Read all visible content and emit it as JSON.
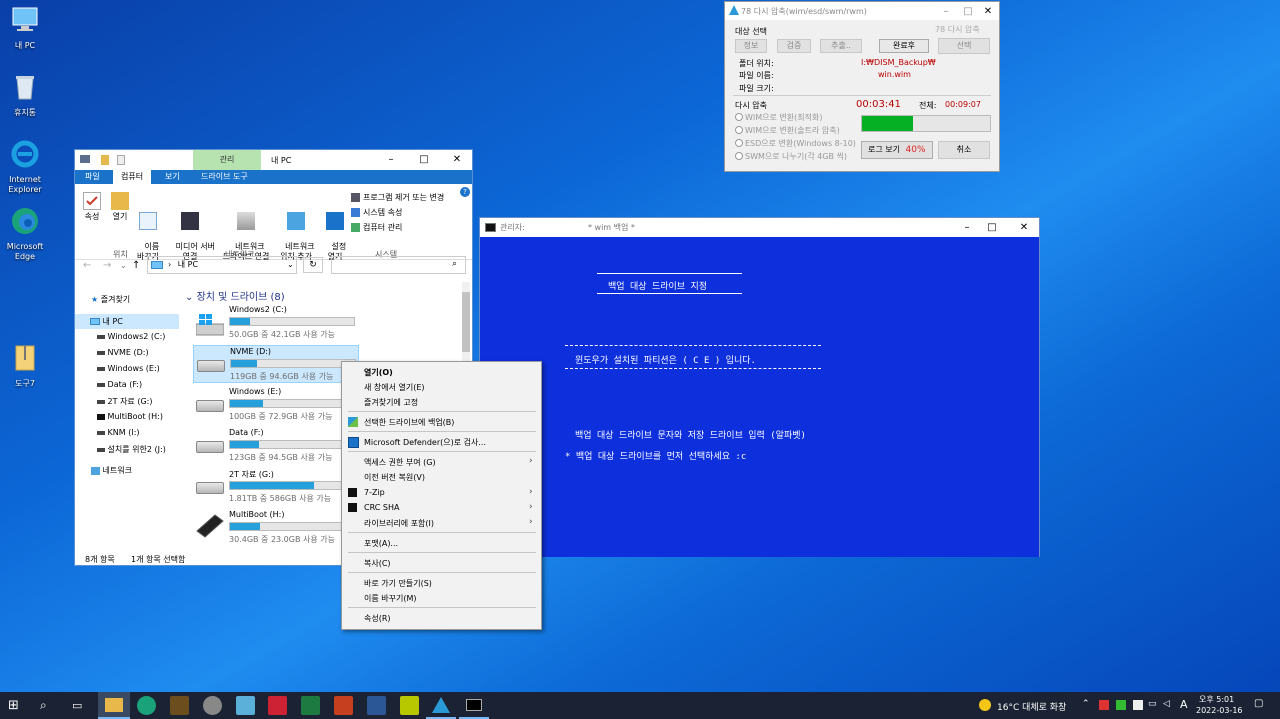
{
  "desktop": {
    "icons": [
      {
        "label": "내 PC"
      },
      {
        "label": "휴지통"
      },
      {
        "label": "Internet Explorer"
      },
      {
        "label": "Microsoft Edge"
      },
      {
        "label": "도구7"
      }
    ]
  },
  "explorer": {
    "ribbon_manage": "관리",
    "title": "내 PC",
    "tabs": [
      "파일",
      "컴퓨터",
      "보기",
      "드라이브 도구"
    ],
    "ribbon": {
      "props": "속성",
      "open": "열기",
      "rename": "이름\n바꾸기",
      "media": "미디어 서버\n연결",
      "netdrive": "네트워크\n드라이브 연결",
      "netloc": "네트워크\n위치 추가",
      "settings": "설정\n열기",
      "uninstall": "프로그램 제거 또는 변경",
      "sysprops": "시스템 속성",
      "compmgmt": "컴퓨터 관리",
      "group_location": "위치",
      "group_network": "네트워크",
      "group_system": "시스템"
    },
    "address": "내 PC",
    "address_sep": "›",
    "nav": {
      "quick": "즐겨찾기",
      "thispc": "내 PC",
      "network": "네트워크",
      "drives": [
        "Windows2 (C:)",
        "NVME (D:)",
        "Windows (E:)",
        "Data (F:)",
        "2T 자료 (G:)",
        "MultiBoot (H:)",
        "KNM (I:)",
        "설치를 위한2 (J:)"
      ]
    },
    "section": "장치 및 드라이브 (8)",
    "drives": [
      {
        "name": "Windows2 (C:)",
        "size": "50.0GB 중 42.1GB 사용 가능",
        "used": 0.16
      },
      {
        "name": "NVME (D:)",
        "size": "119GB 중 94.6GB 사용 가능",
        "used": 0.21
      },
      {
        "name": "Windows (E:)",
        "size": "100GB 중 72.9GB 사용 가능",
        "used": 0.27
      },
      {
        "name": "Data (F:)",
        "size": "123GB 중 94.5GB 사용 가능",
        "used": 0.23
      },
      {
        "name": "2T 자료 (G:)",
        "size": "1.81TB 중 586GB 사용 가능",
        "used": 0.68
      },
      {
        "name": "MultiBoot (H:)",
        "size": "30.4GB 중 23.0GB 사용 가능",
        "used": 0.24
      }
    ],
    "status_count": "8개 항목",
    "status_sel": "1개 항목 선택함"
  },
  "context_menu": [
    "열기(O)",
    "새 창에서 열기(E)",
    "즐겨찾기에 고정",
    "선택한 드라이브에 백업(B)",
    "Microsoft Defender(으)로 검사...",
    "액세스 권한 부여 (G)",
    "이전 버전 복원(V)",
    "7-Zip",
    "CRC SHA",
    "라이브러리에 포함(I)",
    "포맷(A)...",
    "복사(C)",
    "바로 가기 만들기(S)",
    "이름 바꾸기(M)",
    "속성(R)"
  ],
  "cmd": {
    "title": "관리자:",
    "title2": "* wim 백업 *",
    "heading": "백업 대상 드라이브 지정",
    "line1": "윈도우가 설치된 파티션은 ( C E ) 입니다.",
    "line2": "백업 대상 드라이브 문자와 저장 드라이브 입력 (알파벳)",
    "line3": "* 백업 대상 드라이브를 먼저 선택하세요 :c"
  },
  "wim": {
    "title": "78 다시 압축(wim/esd/swm/rwm)",
    "ghost_title": "78 다시 압축",
    "target_label": "대상 선택",
    "btns": [
      "정보",
      "검증",
      "추출..",
      "완료후",
      "선택"
    ],
    "folder_label": "폴더 위치:",
    "folder_val": "I:₩DISM_Backup₩",
    "file_label": "파일 이름:",
    "file_val": "win.wim",
    "size_label": "파일 크기:",
    "recomp": "다시 압축",
    "elapsed": "00:03:41",
    "total_label": "전체:",
    "total": "00:09:07",
    "opts": [
      "WIM으로 변환(최적화)",
      "WIM으로 변환(솔트라 압축)",
      "ESD으로 변환(Windows 8-10)",
      "SWM으로 나누기(각 4GB 씩)"
    ],
    "progress": 0.4,
    "progress_text": "40%",
    "log": "로그 보기",
    "cancel": "취소"
  },
  "taskbar": {
    "weather": "16°C 대체로 화창",
    "ime": "A",
    "time": "오후 5:01",
    "date": "2022-03-16"
  },
  "colors": {
    "accent": "#1a72c9",
    "cmd_bg": "#0d2fdc",
    "progress": "#06b025"
  }
}
